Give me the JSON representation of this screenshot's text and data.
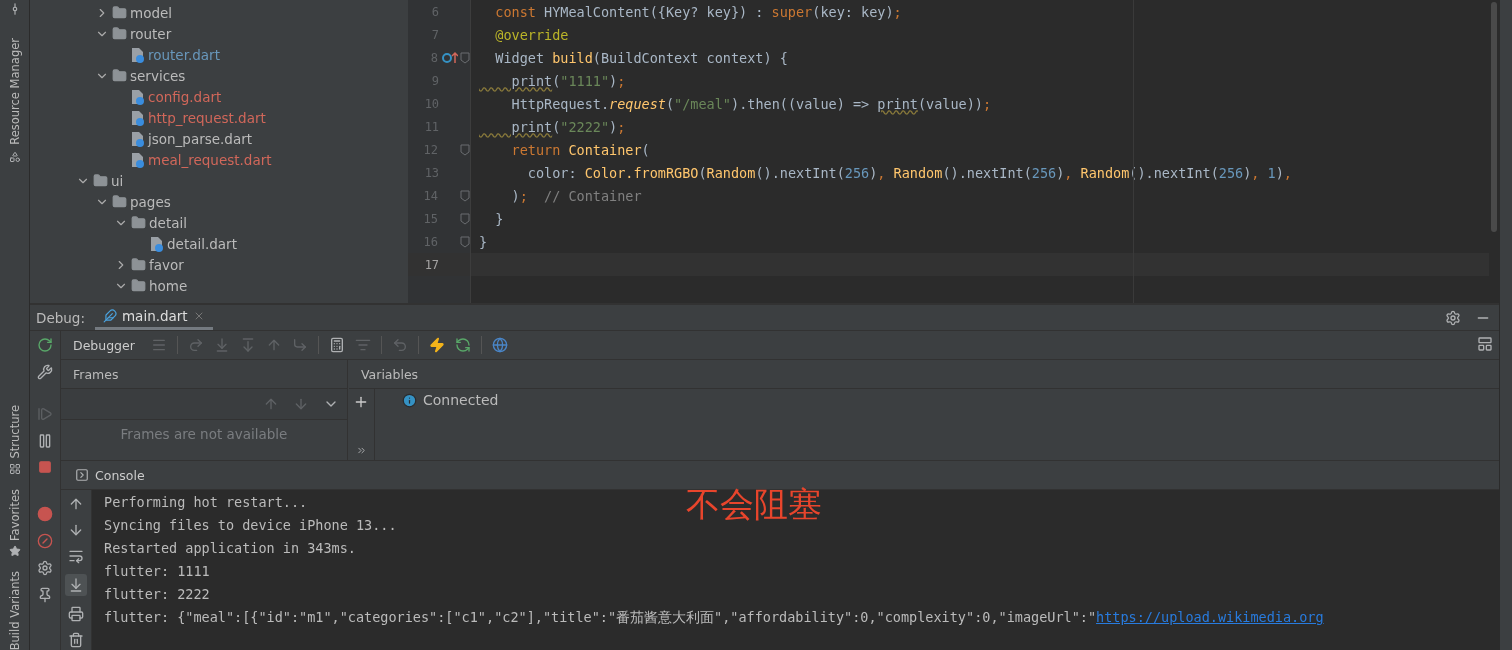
{
  "side_tools": {
    "top": [
      {
        "label": "Resource Manager"
      }
    ],
    "bottom": [
      {
        "label": "Structure"
      },
      {
        "label": "Favorites"
      },
      {
        "label": "Build Variants"
      }
    ]
  },
  "project_tree": [
    {
      "children": [
        {
          "name": "model",
          "kind": "folder",
          "expanded": false
        },
        {
          "name": "router",
          "kind": "folder",
          "expanded": true,
          "children": [
            {
              "name": "router.dart",
              "kind": "file",
              "color": "#6897bb"
            }
          ]
        },
        {
          "name": "services",
          "kind": "folder",
          "expanded": true,
          "children": [
            {
              "name": "config.dart",
              "kind": "file",
              "color": "#d1675a"
            },
            {
              "name": "http_request.dart",
              "kind": "file",
              "color": "#d1675a"
            },
            {
              "name": "json_parse.dart",
              "kind": "file",
              "color": "#bbbbbb"
            },
            {
              "name": "meal_request.dart",
              "kind": "file",
              "color": "#d1675a"
            }
          ]
        }
      ]
    },
    {
      "name": "ui",
      "kind": "folder",
      "expanded": true,
      "children": [
        {
          "name": "pages",
          "kind": "folder",
          "expanded": true,
          "children": [
            {
              "name": "detail",
              "kind": "folder",
              "expanded": true,
              "children": [
                {
                  "name": "detail.dart",
                  "kind": "file",
                  "color": "#bbbbbb"
                }
              ]
            },
            {
              "name": "favor",
              "kind": "folder",
              "expanded": false
            },
            {
              "name": "home",
              "kind": "folder",
              "expanded": true
            }
          ]
        }
      ]
    }
  ],
  "editor": {
    "lines": [
      {
        "number": "6",
        "current": false,
        "fold": false,
        "override": false,
        "tokens": [
          {
            "text": "  const",
            "kind": "kw"
          },
          {
            "text": " HYMealContent({Key? key}) : ",
            "kind": "plain"
          },
          {
            "text": "super",
            "kind": "kw"
          },
          {
            "text": "(key: key)",
            "kind": "plain"
          },
          {
            "text": ";",
            "kind": "kw"
          }
        ]
      },
      {
        "number": "7",
        "current": false,
        "fold": false,
        "override": false,
        "tokens": [
          {
            "text": "  @override",
            "kind": "ann"
          }
        ]
      },
      {
        "number": "8",
        "current": false,
        "fold": true,
        "override": true,
        "tokens": [
          {
            "text": "  Widget ",
            "kind": "plain"
          },
          {
            "text": "build",
            "kind": "fn"
          },
          {
            "text": "(BuildContext context) {",
            "kind": "plain"
          }
        ]
      },
      {
        "number": "9",
        "current": false,
        "fold": false,
        "override": false,
        "tokens": [
          {
            "text": "    print",
            "kind": "warn"
          },
          {
            "text": "(",
            "kind": "plain"
          },
          {
            "text": "\"1111\"",
            "kind": "str"
          },
          {
            "text": ")",
            "kind": "plain"
          },
          {
            "text": ";",
            "kind": "kw"
          }
        ]
      },
      {
        "number": "10",
        "current": false,
        "fold": false,
        "override": false,
        "tokens": [
          {
            "text": "    HttpRequest.",
            "kind": "plain"
          },
          {
            "text": "request",
            "kind": "italic"
          },
          {
            "text": "(",
            "kind": "plain"
          },
          {
            "text": "\"/meal\"",
            "kind": "str"
          },
          {
            "text": ").then((value) => ",
            "kind": "plain"
          },
          {
            "text": "print",
            "kind": "warn"
          },
          {
            "text": "(value))",
            "kind": "plain"
          },
          {
            "text": ";",
            "kind": "kw"
          }
        ]
      },
      {
        "number": "11",
        "current": false,
        "fold": false,
        "override": false,
        "tokens": [
          {
            "text": "    print",
            "kind": "warn"
          },
          {
            "text": "(",
            "kind": "plain"
          },
          {
            "text": "\"2222\"",
            "kind": "str"
          },
          {
            "text": ")",
            "kind": "plain"
          },
          {
            "text": ";",
            "kind": "kw"
          }
        ]
      },
      {
        "number": "12",
        "current": false,
        "fold": true,
        "override": false,
        "tokens": [
          {
            "text": "    return",
            "kind": "kw"
          },
          {
            "text": " Container",
            "kind": "fn"
          },
          {
            "text": "(",
            "kind": "plain"
          }
        ]
      },
      {
        "number": "13",
        "current": false,
        "fold": false,
        "override": false,
        "tokens": [
          {
            "text": "      color: ",
            "kind": "plain"
          },
          {
            "text": "Color.fromRGBO",
            "kind": "fn"
          },
          {
            "text": "(",
            "kind": "plain"
          },
          {
            "text": "Random",
            "kind": "fn"
          },
          {
            "text": "().nextInt(",
            "kind": "plain"
          },
          {
            "text": "256",
            "kind": "num"
          },
          {
            "text": ")",
            "kind": "plain"
          },
          {
            "text": ", ",
            "kind": "kw"
          },
          {
            "text": "Random",
            "kind": "fn"
          },
          {
            "text": "().nextInt(",
            "kind": "plain"
          },
          {
            "text": "256",
            "kind": "num"
          },
          {
            "text": ")",
            "kind": "plain"
          },
          {
            "text": ", ",
            "kind": "kw"
          },
          {
            "text": "Random",
            "kind": "fn"
          },
          {
            "text": "().nextInt(",
            "kind": "plain"
          },
          {
            "text": "256",
            "kind": "num"
          },
          {
            "text": ")",
            "kind": "plain"
          },
          {
            "text": ", ",
            "kind": "kw"
          },
          {
            "text": "1",
            "kind": "num"
          },
          {
            "text": ")",
            "kind": "plain"
          },
          {
            "text": ",",
            "kind": "kw"
          }
        ]
      },
      {
        "number": "14",
        "current": false,
        "fold": true,
        "override": false,
        "tokens": [
          {
            "text": "    )",
            "kind": "plain"
          },
          {
            "text": ";",
            "kind": "kw"
          },
          {
            "text": "  // Container",
            "kind": "cmt"
          }
        ]
      },
      {
        "number": "15",
        "current": false,
        "fold": true,
        "override": false,
        "tokens": [
          {
            "text": "  }",
            "kind": "plain"
          }
        ]
      },
      {
        "number": "16",
        "current": false,
        "fold": true,
        "override": false,
        "tokens": [
          {
            "text": "}",
            "kind": "plain"
          }
        ]
      },
      {
        "number": "17",
        "current": true,
        "fold": false,
        "override": false
      }
    ]
  },
  "debug": {
    "title": "Debug:",
    "tabs": [
      {
        "label": "main.dart",
        "selected": true
      }
    ],
    "toolbar_tab": "Debugger",
    "frames": {
      "title": "Frames",
      "empty": "Frames are not available"
    },
    "variables": {
      "title": "Variables",
      "status": "Connected"
    },
    "console": {
      "title": "Console",
      "lines": [
        {
          "text": "Performing hot restart..."
        },
        {
          "text": "Syncing files to device iPhone 13..."
        },
        {
          "text": "Restarted application in 343ms."
        },
        {
          "text": "flutter: 1111"
        },
        {
          "text": "flutter: 2222"
        },
        {
          "text": "flutter: {\"meal\":[{\"id\":\"m1\",\"categories\":[\"c1\",\"c2\"],\"title\":\"番茄酱意大利面\",\"affordability\":0,\"complexity\":0,\"imageUrl\":\"",
          "link": "https://upload.wikimedia.org"
        }
      ]
    }
  },
  "annotation": {
    "text": "不会阻塞"
  }
}
